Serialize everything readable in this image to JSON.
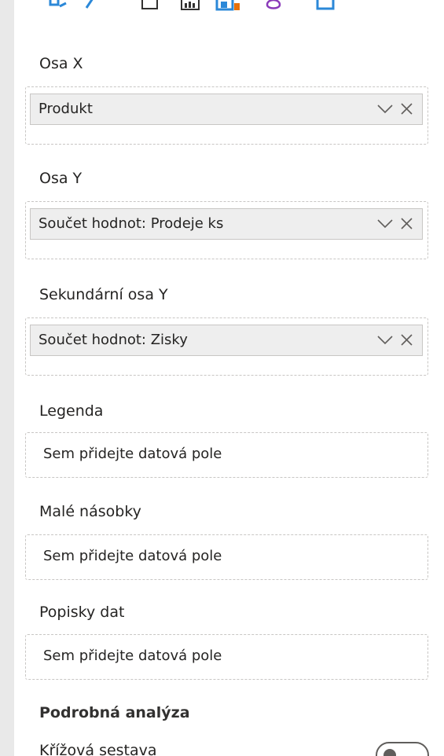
{
  "sections": {
    "x_axis": {
      "label": "Osa X",
      "field": "Produkt"
    },
    "y_axis": {
      "label": "Osa Y",
      "field": "Součet hodnot: Prodeje ks"
    },
    "secondary_y_axis": {
      "label": "Sekundární osa Y",
      "field": "Součet hodnot: Zisky"
    },
    "legend": {
      "label": "Legenda",
      "placeholder": "Sem přidejte datová pole"
    },
    "small_multiples": {
      "label": "Malé násobky",
      "placeholder": "Sem přidejte datová pole"
    },
    "tooltips": {
      "label": "Popisky dat",
      "placeholder": "Sem přidejte datová pole"
    }
  },
  "drillthrough": {
    "heading": "Podrobná analýza",
    "cross_report_label": "Křížová sestava",
    "cross_report_state": "off"
  },
  "icons": {
    "top_strip": [
      "format-icon",
      "analytics-icon",
      "blank-visual-icon",
      "table-visual-icon",
      "chart-visual-icon",
      "custom-visual-icon",
      "more-visual-icon"
    ],
    "field_actions": [
      "chevron-down-icon",
      "close-icon"
    ]
  },
  "colors": {
    "accent_blue": "#2b88d8",
    "accent_orange": "#e8710a",
    "accent_purple": "#8a3ab9"
  }
}
